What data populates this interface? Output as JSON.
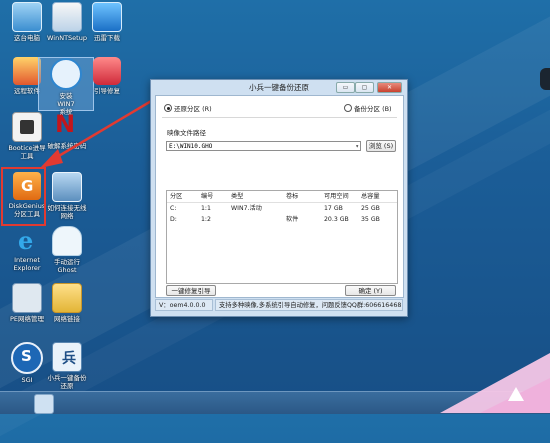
{
  "desktop_icons": [
    {
      "label": "这台电脑",
      "icon": "computer-icon"
    },
    {
      "label": "WinNTSetup",
      "icon": "winntsetup-icon"
    },
    {
      "label": "迅雷下载",
      "icon": "thunder-icon"
    },
    {
      "label": "远程软件",
      "icon": "remote-icon"
    },
    {
      "label": "安装\nWIN7\n系统",
      "icon": "install-win7-icon"
    },
    {
      "label": "引导修复",
      "icon": "boot-repair-icon"
    },
    {
      "label": "Bootice进导\n工具",
      "icon": "bootice-icon"
    },
    {
      "label": "破解系统密码",
      "icon": "password-crack-icon"
    },
    {
      "label": "DiskGenius\n分区工具",
      "icon": "diskgenius-icon"
    },
    {
      "label": "如何连接无线\n网络",
      "icon": "wireless-help-icon"
    },
    {
      "label": "Internet\nExplorer",
      "icon": "ie-icon"
    },
    {
      "label": "手动运行\nGhost",
      "icon": "ghost-icon"
    },
    {
      "label": "PE网络管理",
      "icon": "network-manager-icon"
    },
    {
      "label": "网络链接",
      "icon": "network-link-icon"
    },
    {
      "label": "SGI",
      "icon": "sgi-icon"
    },
    {
      "label": "小兵一键备份\n还原",
      "icon": "backup-restore-icon"
    }
  ],
  "dialog": {
    "title": "小兵一键备份还原",
    "radio_restore": "还原分区 (R)",
    "radio_backup": "备份分区 (B)",
    "image_path_label": "映像文件路径",
    "image_path_value": "E:\\WIN10.GHO",
    "browse_button": "浏览 (S)",
    "table": {
      "headers": [
        "分区",
        "编号",
        "类型",
        "卷标",
        "可用空间",
        "总容量"
      ],
      "rows": [
        [
          "C:",
          "1:1",
          "WIN7.活动",
          "",
          "17 GB",
          "25 GB"
        ],
        [
          "D:",
          "1:2",
          "",
          "软件",
          "20.3 GB",
          "35 GB"
        ]
      ]
    },
    "repair_boot_button": "一键修复引导",
    "ok_button": "确定 (Y)",
    "status_version": "V：oem4.0.0.0",
    "status_message": "支持多种映像,多系统引导自动修复，问题反馈QQ群:606616468"
  },
  "colors": {
    "desktop_bg": "#1b5d97",
    "selection_border": "#e23a31",
    "arrow": "#e23a31",
    "dialog_frame": "#cfe0f1"
  }
}
